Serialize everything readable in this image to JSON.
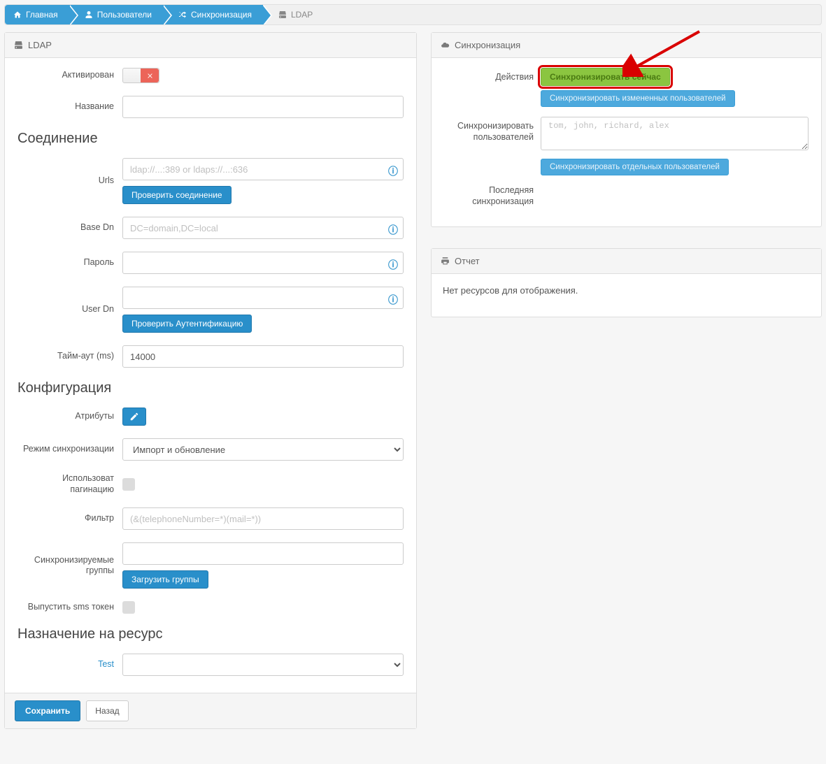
{
  "breadcrumb": {
    "home": "Главная",
    "users": "Пользователи",
    "sync": "Синхронизация",
    "ldap": "LDAP"
  },
  "ldapPanel": {
    "title": "LDAP",
    "activated_label": "Активирован",
    "name_label": "Название",
    "name_value": "",
    "section_connection": "Соединение",
    "urls_label": "Urls",
    "urls_placeholder": "ldap://...:389 or ldaps://...:636",
    "check_connection_btn": "Проверить соединение",
    "basedn_label": "Base Dn",
    "basedn_placeholder": "DC=domain,DC=local",
    "password_label": "Пароль",
    "userdn_label": "User Dn",
    "check_auth_btn": "Проверить Аутентификацию",
    "timeout_label": "Тайм-аут (ms)",
    "timeout_value": "14000",
    "section_config": "Конфигурация",
    "attributes_label": "Атрибуты",
    "sync_mode_label": "Режим синхронизации",
    "sync_mode_selected": "Импорт и обновление",
    "pagination_label": "Использоват пагинацию",
    "filter_label": "Фильтр",
    "filter_placeholder": "(&(telephoneNumber=*)(mail=*))",
    "sync_groups_label": "Синхронизируемые группы",
    "load_groups_btn": "Загрузить группы",
    "release_sms_label": "Выпустить sms токен",
    "section_resource": "Назначение на ресурс",
    "test_label": "Test",
    "save_btn": "Сохранить",
    "back_btn": "Назад"
  },
  "syncPanel": {
    "title": "Синхронизация",
    "actions_label": "Действия",
    "sync_now_btn": "Синхронизировать сейчас",
    "sync_changed_btn": "Синхронизировать измененных пользователей",
    "sync_users_label": "Синхронизировать пользователей",
    "sync_users_placeholder": "tom, john, richard, alex",
    "sync_individual_btn": "Синхронизировать отдельных пользователей",
    "last_sync_label": "Последняя синхронизация"
  },
  "reportPanel": {
    "title": "Отчет",
    "no_resources": "Нет ресурсов для отображения."
  }
}
